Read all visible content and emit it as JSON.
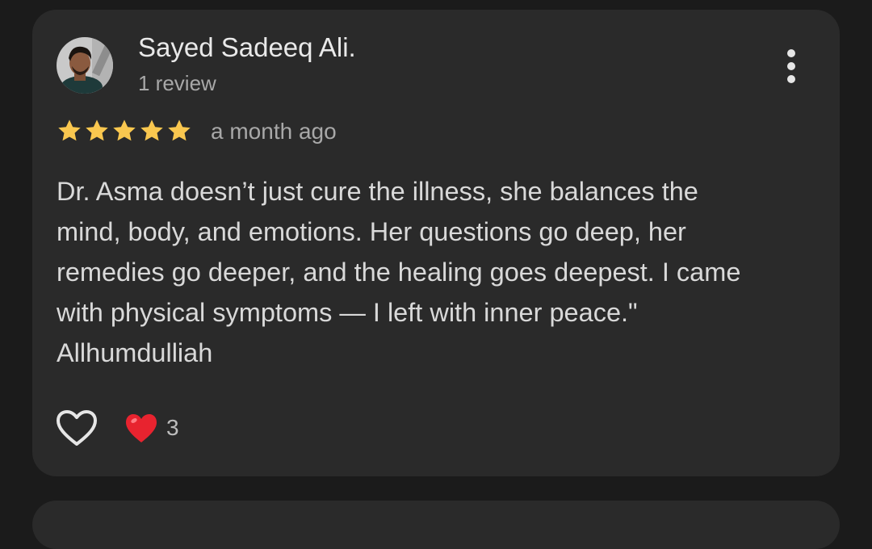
{
  "review": {
    "author_name": "Sayed Sadeeq Ali.",
    "author_meta": "1 review",
    "rating": 5,
    "rating_max": 5,
    "time_ago": "a month ago",
    "text": "Dr. Asma doesn’t just cure the illness, she balances the\nmind, body, and emotions. Her questions go deep, her\nremedies go deeper, and the healing goes deepest. I came\nwith physical symptoms — I left with inner peace.\"\nAllhumdulliah",
    "reaction_count": "3"
  },
  "icons": {
    "menu": "more-vertical-icon",
    "like": "heart-outline-icon",
    "reaction": "red-heart-icon",
    "star": "star-icon"
  },
  "colors": {
    "page_bg": "#1b1b1b",
    "card_bg": "#2a2a2a",
    "star": "#f9c74f",
    "heart_reaction": "#e8232f",
    "primary_text": "#e9e9e9",
    "secondary_text": "#a8a8a8"
  }
}
